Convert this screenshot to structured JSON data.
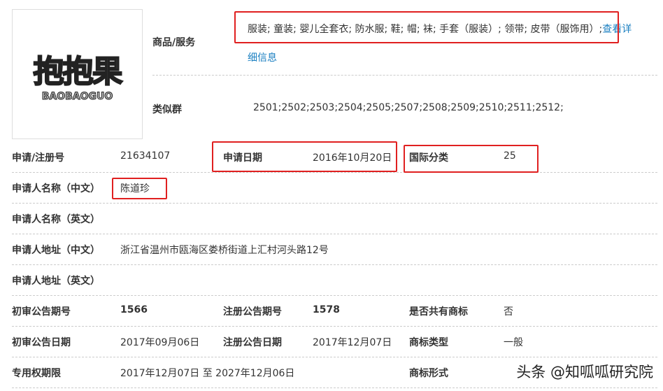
{
  "logo": {
    "cn": "抱抱果",
    "en": "BAOBAOGUO"
  },
  "goods": {
    "label": "商品/服务",
    "value": "服装; 童装; 婴儿全套衣; 防水服; 鞋; 帽; 袜; 手套（服装）; 领带; 皮带（服饰用）;",
    "link1": "查看详",
    "link2": "细信息"
  },
  "similar": {
    "label": "类似群",
    "value": "2501;2502;2503;2504;2505;2507;2508;2509;2510;2511;2512;"
  },
  "rows": {
    "reg_no": {
      "label": "申请/注册号",
      "value": "21634107"
    },
    "app_date": {
      "label": "申请日期",
      "value": "2016年10月20日"
    },
    "intl_class": {
      "label": "国际分类",
      "value": "25"
    },
    "applicant_cn": {
      "label": "申请人名称（中文）",
      "value": "陈道珍"
    },
    "applicant_en": {
      "label": "申请人名称（英文）"
    },
    "address_cn": {
      "label": "申请人地址（中文）",
      "value": "浙江省温州市瓯海区娄桥街道上汇村河头路12号"
    },
    "address_en": {
      "label": "申请人地址（英文）"
    },
    "prelim_no": {
      "label": "初审公告期号",
      "value": "1566"
    },
    "reg_pub_no": {
      "label": "注册公告期号",
      "value": "1578"
    },
    "shared": {
      "label": "是否共有商标",
      "value": "否"
    },
    "prelim_date": {
      "label": "初审公告日期",
      "value": "2017年09月06日"
    },
    "reg_pub_date": {
      "label": "注册公告日期",
      "value": "2017年12月07日"
    },
    "tm_type": {
      "label": "商标类型",
      "value": "一般"
    },
    "exclusive": {
      "label": "专用权期限",
      "value": "2017年12月07日 至 2027年12月06日"
    },
    "tm_form": {
      "label": "商标形式"
    }
  },
  "watermark": "头条 @知呱呱研究院"
}
